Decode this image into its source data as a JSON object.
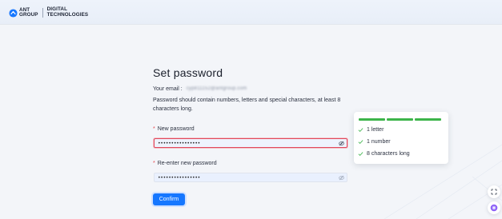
{
  "header": {
    "logo_word_line1": "ANT",
    "logo_word_line2": "GROUP",
    "logo_sub_line1": "DIGITAL",
    "logo_sub_line2": "TECHNOLOGIES"
  },
  "form": {
    "title": "Set password",
    "email_label": "Your email :",
    "email_value": "cyp811152@antgroup.com",
    "hint": "Password should contain numbers, letters and special characters, at least 8 characters long.",
    "new_password_label": "New password",
    "new_password_value": "••••••••••••••••",
    "reenter_label": "Re-enter new password",
    "reenter_value": "••••••••••••••••",
    "confirm_label": "Confirm",
    "required_mark": "*"
  },
  "strength_popover": {
    "strength_segments_filled": 3,
    "rules": [
      {
        "label": "1 letter",
        "met": true
      },
      {
        "label": "1 number",
        "met": true
      },
      {
        "label": "8 characters long",
        "met": true
      }
    ]
  },
  "colors": {
    "primary": "#1677ff",
    "success": "#3cb44a",
    "error": "#e1485c"
  },
  "icons": {
    "eye": "eye-off-icon",
    "check": "check-icon",
    "expand": "expand-icon",
    "assistant": "ai-assistant-icon"
  }
}
